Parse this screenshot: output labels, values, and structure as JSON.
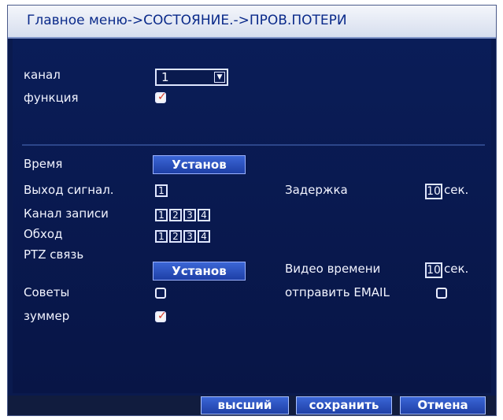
{
  "title": "Главное меню->СОСТОЯНИЕ.->ПРОВ.ПОТЕРИ",
  "fields": {
    "channel": {
      "label": "канал",
      "value": "1"
    },
    "function": {
      "label": "функция",
      "checked": true
    },
    "time": {
      "label": "Время",
      "button": "Установ"
    },
    "alarm_out": {
      "label": "Выход сигнал.",
      "items": [
        "1"
      ]
    },
    "delay": {
      "label": "Задержка",
      "value": "10",
      "unit": "сек."
    },
    "record_channel": {
      "label": "Канал записи",
      "items": [
        "1",
        "2",
        "3",
        "4"
      ]
    },
    "tour": {
      "label": "Обход",
      "items": [
        "1",
        "2",
        "3",
        "4"
      ]
    },
    "ptz": {
      "label": "PTZ связь",
      "button": "Установ"
    },
    "video_time": {
      "label": "Видео времени",
      "value": "10",
      "unit": "сек."
    },
    "tips": {
      "label": "Советы",
      "checked": false
    },
    "send_email": {
      "label": "отправить EMAIL",
      "checked": false
    },
    "buzzer": {
      "label": "зуммер",
      "checked": true
    }
  },
  "footer": {
    "advanced": "высший",
    "save": "сохранить",
    "cancel": "Отмена"
  },
  "colors": {
    "panel": "#0a1a4e",
    "button": "#2a52c6",
    "title_text": "#0a2a8a",
    "checkmark": "#d63a2a"
  }
}
